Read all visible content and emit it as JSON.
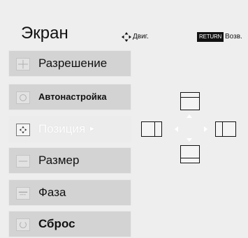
{
  "header": {
    "title": "Экран",
    "move_hint": "Двиг.",
    "return_badge": "RETURN",
    "back_hint": "Возв."
  },
  "menu": {
    "items": [
      {
        "label": "Разрешение",
        "icon": "resolution-icon"
      },
      {
        "label": "Автонастройка",
        "icon": "auto-adjust-icon"
      },
      {
        "label": "Позиция",
        "icon": "position-icon",
        "selected": true,
        "arrow": "►"
      },
      {
        "label": "Размер",
        "icon": "size-icon"
      },
      {
        "label": "Фаза",
        "icon": "phase-icon"
      },
      {
        "label": "Сброс",
        "icon": "reset-icon"
      }
    ]
  },
  "colors": {
    "menu_item_bg": "#d3d3d3",
    "selected_bg": "#ececec",
    "text": "#111111",
    "selected_text": "#ffffff"
  }
}
